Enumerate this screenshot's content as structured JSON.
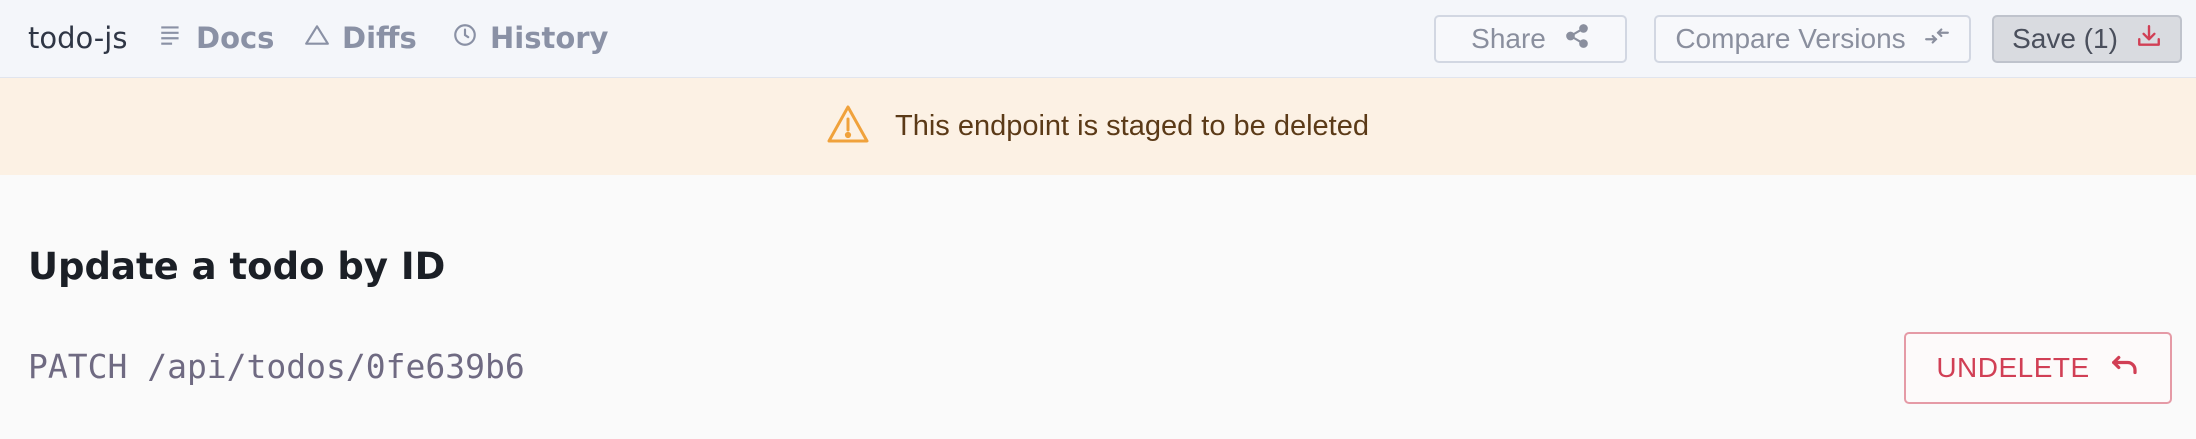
{
  "header": {
    "project_name": "todo-js",
    "nav": [
      {
        "label": "Docs",
        "icon": "docs-icon"
      },
      {
        "label": "Diffs",
        "icon": "diffs-icon"
      },
      {
        "label": "History",
        "icon": "history-icon"
      }
    ],
    "share_label": "Share",
    "compare_label": "Compare Versions",
    "save_label": "Save (1)"
  },
  "banner": {
    "icon": "warning-icon",
    "message": "This endpoint is staged to be deleted",
    "colors": {
      "background": "#fcf1e4",
      "icon": "#f0a23c",
      "text": "#5b3a17"
    }
  },
  "endpoint": {
    "title": "Update a todo by ID",
    "method_path": "PATCH /api/todos/0fe639b6",
    "undelete_label": "UNDELETE"
  },
  "colors": {
    "accent_danger": "#d13f55",
    "nav_text": "#8a91a5",
    "topbar_bg": "#f4f6fa"
  }
}
